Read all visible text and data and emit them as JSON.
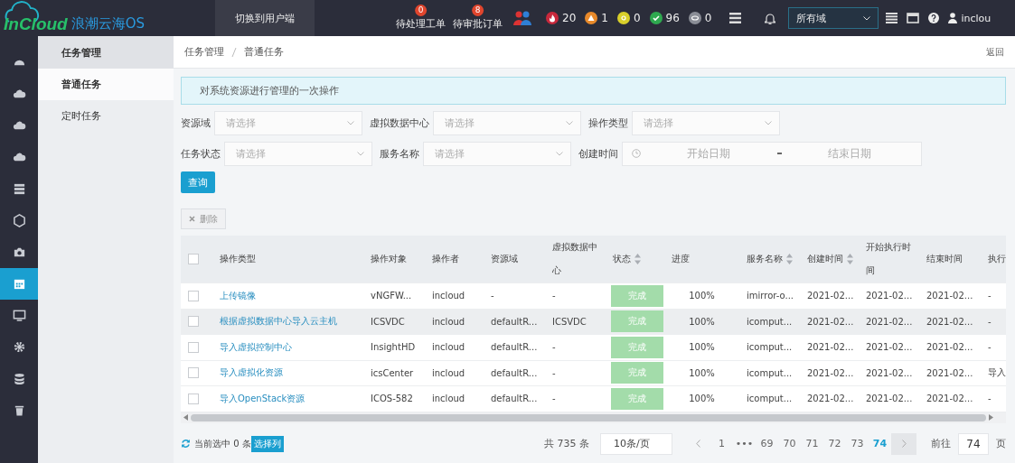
{
  "topbar": {
    "logo": {
      "brand": "InCloud",
      "product": "浪潮云海OS"
    },
    "switch_button": "切换到用户端",
    "work_items": [
      {
        "label": "待处理工单",
        "badge": "0"
      },
      {
        "label": "待审批订单",
        "badge": "8"
      }
    ],
    "alert_counts": [
      {
        "kind": "fire",
        "count": "20",
        "color": "#c8283c"
      },
      {
        "kind": "warning",
        "count": "1",
        "color": "#e8892a"
      },
      {
        "kind": "minor",
        "count": "0",
        "color": "#d8cf2a"
      },
      {
        "kind": "ok",
        "count": "96",
        "color": "#2ea84f"
      },
      {
        "kind": "hidden",
        "count": "0",
        "color": "#8a8d96"
      }
    ],
    "domain_select": {
      "value": "所有域"
    },
    "user": "inclou"
  },
  "sidebar": {
    "icons": [
      {
        "kind": "dashboard",
        "selected": false
      },
      {
        "kind": "cloud",
        "selected": false
      },
      {
        "kind": "cloud",
        "selected": false
      },
      {
        "kind": "cloud",
        "selected": false
      },
      {
        "kind": "server",
        "selected": false
      },
      {
        "kind": "cube",
        "selected": false
      },
      {
        "kind": "camera",
        "selected": false
      },
      {
        "kind": "calendar",
        "selected": true
      },
      {
        "kind": "monitor",
        "selected": false
      },
      {
        "kind": "gear",
        "selected": false
      },
      {
        "kind": "database",
        "selected": false
      },
      {
        "kind": "trash",
        "selected": false
      }
    ]
  },
  "submenu": {
    "title": "任务管理",
    "items": [
      {
        "label": "普通任务",
        "selected": true
      },
      {
        "label": "定时任务",
        "selected": false
      }
    ]
  },
  "breadcrumb": {
    "items": [
      "任务管理",
      "普通任务"
    ],
    "back": "返回"
  },
  "notice": "对系统资源进行管理的一次操作",
  "filters": [
    [
      {
        "label": "资源域",
        "placeholder": "请选择",
        "kind": "select"
      },
      {
        "label": "虚拟数据中心",
        "placeholder": "请选择",
        "kind": "select"
      },
      {
        "label": "操作类型",
        "placeholder": "请选择",
        "kind": "select"
      }
    ],
    [
      {
        "label": "任务状态",
        "placeholder": "请选择",
        "kind": "select"
      },
      {
        "label": "服务名称",
        "placeholder": "请选择",
        "kind": "select"
      },
      {
        "label": "创建时间",
        "kind": "daterange",
        "start_placeholder": "开始日期",
        "end_placeholder": "结束日期"
      }
    ]
  ],
  "query_button": "查询",
  "delete_button": {
    "label": "删除",
    "disabled": true
  },
  "table": {
    "all_checked": false,
    "columns": [
      {
        "label": "操作类型",
        "sortable": false
      },
      {
        "label": "操作对象",
        "sortable": false
      },
      {
        "label": "操作者",
        "sortable": false
      },
      {
        "label": "资源域",
        "sortable": false
      },
      {
        "label": "虚拟数据中心",
        "sortable": false
      },
      {
        "label": "状态",
        "sortable": true
      },
      {
        "label": "进度",
        "sortable": false
      },
      {
        "label": "服务名称",
        "sortable": true
      },
      {
        "label": "创建时间",
        "sortable": true
      },
      {
        "label": "开始执行时间",
        "sortable": false
      },
      {
        "label": "结束时间",
        "sortable": false
      },
      {
        "label": "执行",
        "sortable": false
      }
    ],
    "rows": [
      {
        "checked": false,
        "highlighted": false,
        "cells": [
          "上传镜像",
          "vNGFW...",
          "incloud",
          "-",
          "-",
          "完成",
          "100%",
          "imirror-o...",
          "2021-02...",
          "2021-02...",
          "2021-02...",
          "-"
        ]
      },
      {
        "checked": false,
        "highlighted": true,
        "cells": [
          "根据虚拟数据中心导入云主机",
          "ICSVDC",
          "incloud",
          "defaultR...",
          "ICSVDC",
          "完成",
          "100%",
          "icomput...",
          "2021-02...",
          "2021-02...",
          "2021-02...",
          "-"
        ]
      },
      {
        "checked": false,
        "highlighted": false,
        "cells": [
          "导入虚拟控制中心",
          "InsightHD",
          "incloud",
          "defaultR...",
          "-",
          "完成",
          "100%",
          "icomput...",
          "2021-02...",
          "2021-02...",
          "2021-02...",
          "-"
        ]
      },
      {
        "checked": false,
        "highlighted": false,
        "cells": [
          "导入虚拟化资源",
          "icsCenter",
          "incloud",
          "defaultR...",
          "-",
          "完成",
          "100%",
          "icomput...",
          "2021-02...",
          "2021-02...",
          "2021-02...",
          "导入"
        ]
      },
      {
        "checked": false,
        "highlighted": false,
        "cells": [
          "导入OpenStack资源",
          "ICOS-582",
          "incloud",
          "defaultR...",
          "-",
          "完成",
          "100%",
          "icomput...",
          "2021-02...",
          "2021-02...",
          "2021-02...",
          "-"
        ]
      }
    ]
  },
  "footer": {
    "selection": "当前选中 0 条",
    "choose_columns": "选择列",
    "total": "共 735 条",
    "page_size": "10条/页",
    "pages": [
      {
        "label": "1",
        "selected": false
      },
      {
        "label": "•••",
        "selected": false
      },
      {
        "label": "69",
        "selected": false
      },
      {
        "label": "70",
        "selected": false
      },
      {
        "label": "71",
        "selected": false
      },
      {
        "label": "72",
        "selected": false
      },
      {
        "label": "73",
        "selected": false
      },
      {
        "label": "74",
        "selected": true
      }
    ],
    "goto_label": "前往",
    "goto_value": "74",
    "page_unit": "页"
  }
}
